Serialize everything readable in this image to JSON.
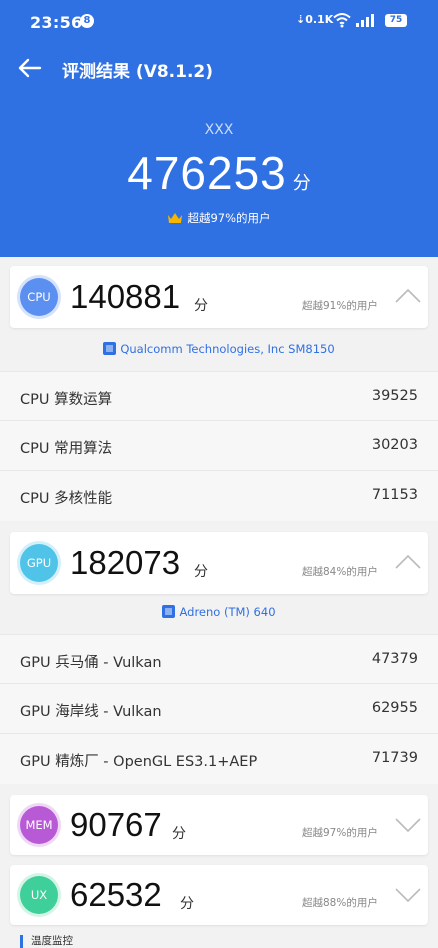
{
  "status_bar": {
    "time": "23:56",
    "notif_count": "8",
    "net_speed": "0.1K",
    "battery": "75"
  },
  "nav": {
    "title": "评测结果 (V8.1.2)"
  },
  "summary": {
    "device": "XXX",
    "total_score": "476253",
    "unit": "分",
    "rank": "超越97%的用户"
  },
  "cpu": {
    "badge": "CPU",
    "score": "140881",
    "unit": "分",
    "rank": "超越91%的用户",
    "chip": "Qualcomm Technologies, Inc SM8150",
    "items": [
      {
        "label": "CPU 算数运算",
        "value": "39525"
      },
      {
        "label": "CPU 常用算法",
        "value": "30203"
      },
      {
        "label": "CPU 多核性能",
        "value": "71153"
      }
    ]
  },
  "gpu": {
    "badge": "GPU",
    "score": "182073",
    "unit": "分",
    "rank": "超越84%的用户",
    "chip": "Adreno (TM) 640",
    "items": [
      {
        "label": "GPU 兵马俑 - Vulkan",
        "value": "47379"
      },
      {
        "label": "GPU 海岸线 - Vulkan",
        "value": "62955"
      },
      {
        "label": "GPU 精炼厂 - OpenGL ES3.1+AEP",
        "value": "71739"
      }
    ]
  },
  "mem": {
    "badge": "MEM",
    "score": "90767",
    "unit": "分",
    "rank": "超越97%的用户"
  },
  "ux": {
    "badge": "UX",
    "score": "62532",
    "unit": "分",
    "rank": "超越88%的用户"
  },
  "section": {
    "temperature_title": "温度监控"
  },
  "colors": {
    "header_blue": "#2f70e3",
    "cpu_badge": "#5b8ff0",
    "gpu_badge": "#4fc3e8",
    "mem_badge": "#b85ad6",
    "ux_badge": "#3fcf9a"
  },
  "icons": {
    "back": "arrow-left-icon",
    "crown": "crown-icon",
    "chip": "chip-icon",
    "collapse": "chevron-up-icon",
    "expand": "chevron-down-icon"
  }
}
